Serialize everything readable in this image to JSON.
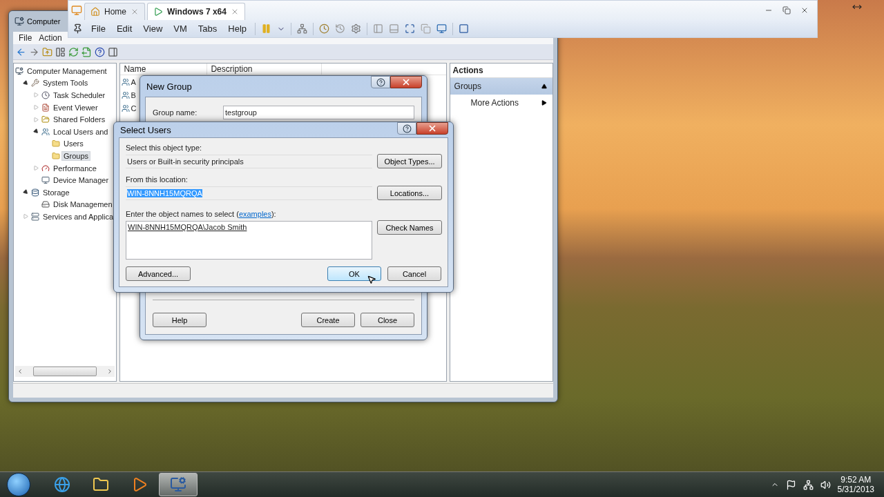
{
  "mmc": {
    "title": "Computer",
    "menu": [
      "File",
      "Action"
    ],
    "tree": [
      {
        "label": "Computer Management",
        "kind": "computer",
        "selected": false,
        "children": [
          {
            "label": "System Tools",
            "kind": "tools",
            "expanded": true,
            "selected": false,
            "children": [
              {
                "label": "Task Scheduler",
                "kind": "clock",
                "expanded": false,
                "selected": false
              },
              {
                "label": "Event Viewer",
                "kind": "viewer",
                "expanded": false,
                "selected": false
              },
              {
                "label": "Shared Folders",
                "kind": "share",
                "expanded": false,
                "selected": false
              },
              {
                "label": "Local Users and",
                "kind": "users",
                "expanded": true,
                "selected": false,
                "children": [
                  {
                    "label": "Users",
                    "kind": "folder",
                    "selected": false
                  },
                  {
                    "label": "Groups",
                    "kind": "folder",
                    "selected": true
                  }
                ]
              },
              {
                "label": "Performance",
                "kind": "perf",
                "expanded": false,
                "selected": false
              },
              {
                "label": "Device Manager",
                "kind": "device",
                "selected": false
              }
            ]
          },
          {
            "label": "Storage",
            "kind": "storage",
            "expanded": true,
            "selected": false,
            "children": [
              {
                "label": "Disk Managemen",
                "kind": "disk",
                "selected": false
              }
            ]
          },
          {
            "label": "Services and Applica",
            "kind": "services",
            "expanded": false,
            "selected": false
          }
        ]
      }
    ],
    "columns": [
      "Name",
      "Description"
    ],
    "rows": [
      "A",
      "B",
      "C"
    ],
    "actions": {
      "title": "Actions",
      "section": "Groups",
      "items": [
        "More Actions"
      ]
    }
  },
  "vmware": {
    "tabs": [
      {
        "label": "Home",
        "kind": "home",
        "selected": false
      },
      {
        "label": "Windows 7 x64",
        "kind": "vm",
        "selected": true
      }
    ],
    "menu": [
      "File",
      "Edit",
      "View",
      "VM",
      "Tabs",
      "Help"
    ]
  },
  "new_group": {
    "title": "New Group",
    "group_name_label": "Group name:",
    "group_name": "testgroup",
    "buttons": [
      "Help",
      "Create",
      "Close"
    ]
  },
  "select_users": {
    "title": "Select Users",
    "type_label": "Select this object type:",
    "type_value": "Users or Built-in security principals",
    "type_button": "Object Types...",
    "location_label": "From this location:",
    "location_value": "WIN-8NNH15MQRQA",
    "location_highlighted": true,
    "location_button": "Locations...",
    "names_label": "Enter the object names to select (",
    "names_link": "examples",
    "names_suffix": "):",
    "names_value": "WIN-8NNH15MQRQA\\Jacob Smith",
    "check_button": "Check Names",
    "buttons": [
      {
        "label": "Advanced...",
        "kind": "left",
        "focused": false
      },
      {
        "label": "OK",
        "kind": "right",
        "focused": true
      },
      {
        "label": "Cancel",
        "kind": "right",
        "focused": false
      }
    ]
  },
  "taskbar": {
    "apps": [
      {
        "kind": "browser",
        "active": false
      },
      {
        "kind": "folder",
        "active": false
      },
      {
        "kind": "player",
        "active": false
      },
      {
        "kind": "management",
        "active": true
      }
    ],
    "time": "9:52 AM",
    "date": "5/31/2013"
  }
}
